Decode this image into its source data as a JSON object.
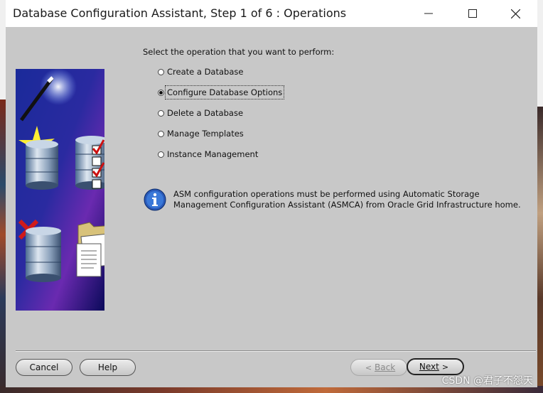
{
  "window": {
    "title": "Database Configuration Assistant, Step 1 of 6 : Operations",
    "controls": {
      "minimize_icon": "minimize-icon",
      "maximize_icon": "maximize-icon",
      "close_icon": "close-icon"
    }
  },
  "main": {
    "prompt": "Select the operation that you want to perform:",
    "options": [
      {
        "label": "Create a Database",
        "selected": false
      },
      {
        "label": "Configure Database Options",
        "selected": true
      },
      {
        "label": "Delete a Database",
        "selected": false
      },
      {
        "label": "Manage Templates",
        "selected": false
      },
      {
        "label": "Instance Management",
        "selected": false
      }
    ],
    "info_line1": "ASM configuration operations must be performed using Automatic Storage",
    "info_line2": "Management Configuration Assistant (ASMCA) from Oracle Grid Infrastructure home."
  },
  "footer": {
    "cancel": "Cancel",
    "help": "Help",
    "back": "Back",
    "next": "Next"
  },
  "watermark": "CSDN @君子不怨天",
  "colors": {
    "dialog_bg": "#c8c8c8",
    "titlebar_bg": "#ffffff",
    "info_blue": "#2a5ab8",
    "check_red": "#cc1111"
  }
}
